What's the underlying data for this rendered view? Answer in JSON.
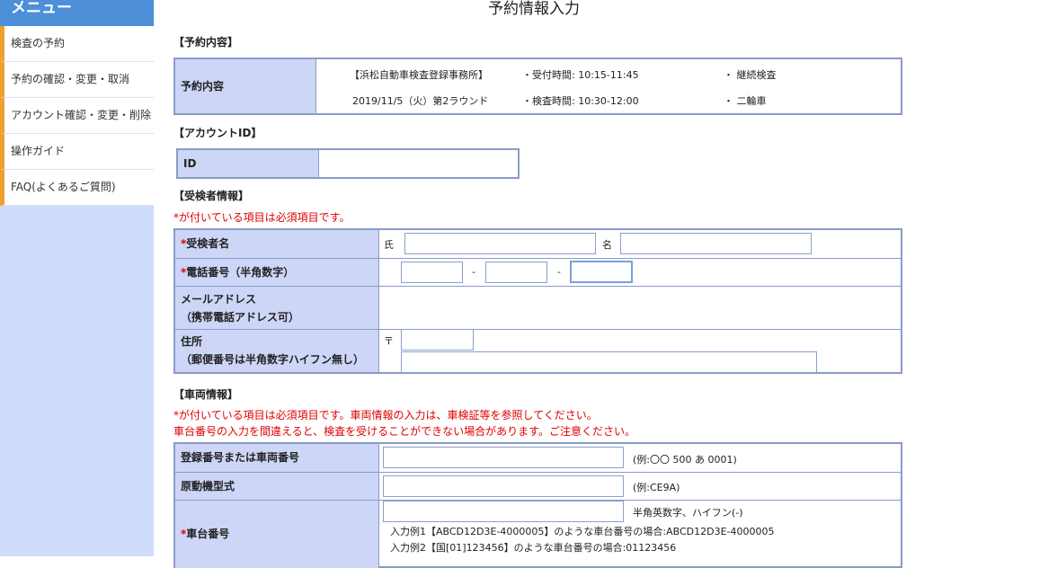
{
  "menu": {
    "title": "メニュー",
    "items": [
      "検査の予約",
      "予約の確認・変更・取消",
      "アカウント確認・変更・削除",
      "操作ガイド",
      "FAQ(よくあるご質問)"
    ]
  },
  "page_title": "予約情報入力",
  "reservation": {
    "section": "【予約内容】",
    "label": "予約内容",
    "office": "【浜松自動車検査登録事務所】",
    "date": "2019/11/5（火）第2ラウンド",
    "reception": "・受付時間: 10:15-11:45",
    "inspection": "・検査時間: 10:30-12:00",
    "type": "・ 継続検査",
    "vehicle_kind": "・ 二輪車"
  },
  "account": {
    "section": "【アカウントID】",
    "id_label": "ID",
    "id_value": ""
  },
  "examinee": {
    "section": "【受検者情報】",
    "note": "*が付いている項目は必須項目です。",
    "name_label": "受検者名",
    "surname": "氏",
    "given": "名",
    "phone_label": "電話番号（半角数字）",
    "dash": "-",
    "email_label1": "メールアドレス",
    "email_label2": "（携帯電話アドレス可）",
    "address_label1": "住所",
    "address_label2": "（郵便番号は半角数字ハイフン無し）",
    "postal_mark": "〒"
  },
  "vehicle": {
    "section": "【車両情報】",
    "note1": "*が付いている項目は必須項目です。車両情報の入力は、車検証等を参照してください。",
    "note2": "車台番号の入力を間違えると、検査を受けることができない場合があります。ご注意ください。",
    "reg_label": "登録番号または車両番号",
    "reg_example": "(例:〇〇 500 あ 0001)",
    "engine_label": "原動機型式",
    "engine_example": "(例:CE9A)",
    "chassis_label": "車台番号",
    "chassis_hint": "半角英数字、ハイフン(-)",
    "chassis_ex1": "入力例1【ABCD12D3E-4000005】のような車台番号の場合:ABCD12D3E-4000005",
    "chassis_ex2": "入力例2【国[01]123456】のような車台番号の場合:01123456"
  },
  "required_mark": "*"
}
